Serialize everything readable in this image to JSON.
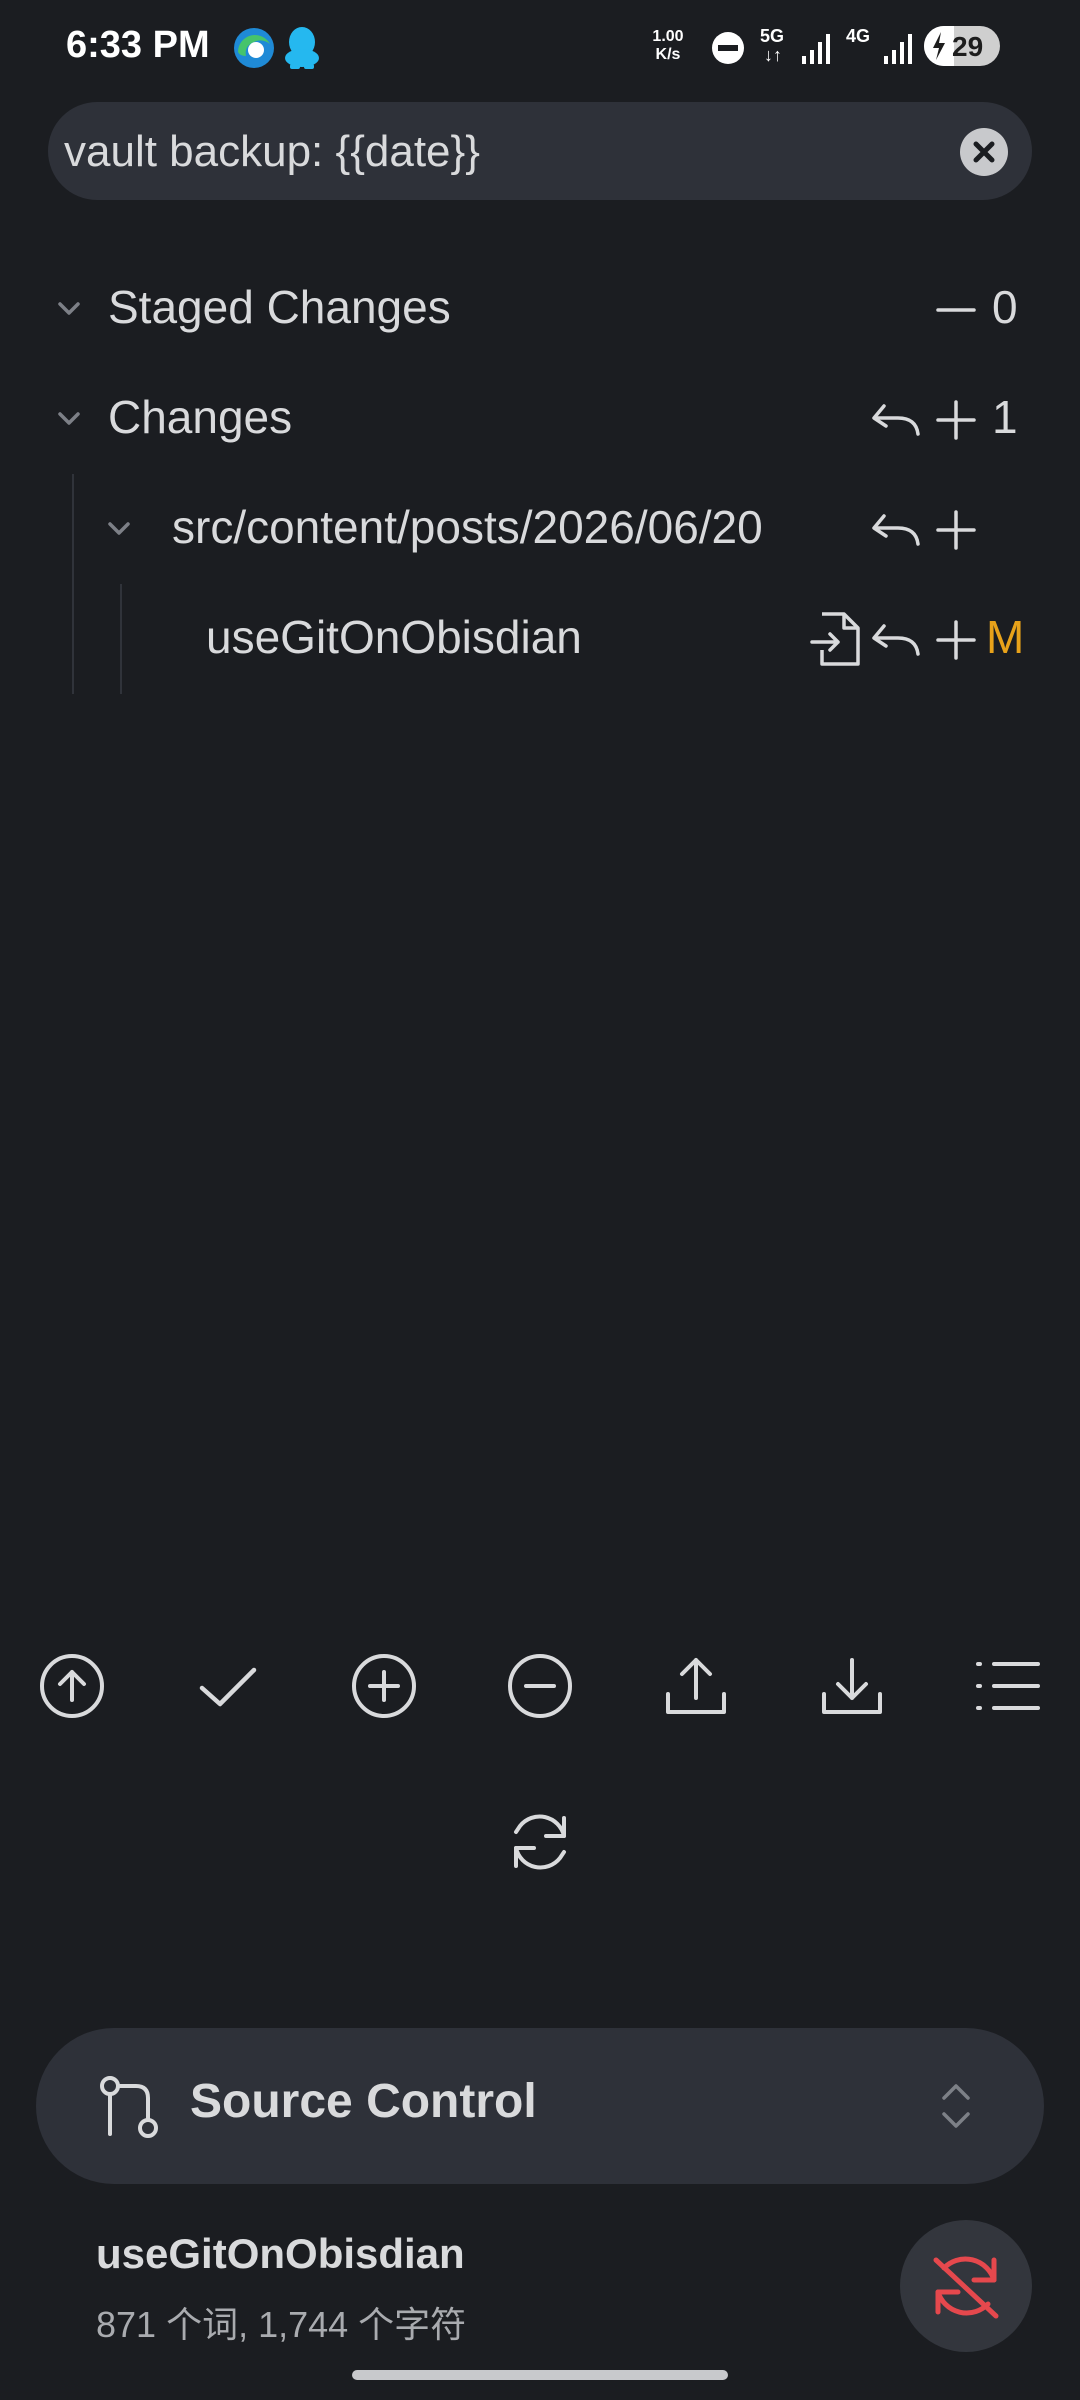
{
  "status_bar": {
    "time": "6:33 PM",
    "net_speed_value": "1.00",
    "net_speed_unit": "K/s",
    "net_5g": "5G",
    "net_4g": "4G",
    "battery": "29"
  },
  "commit": {
    "message": "vault backup: {{date}}"
  },
  "staged": {
    "label": "Staged Changes",
    "count": "0"
  },
  "changes": {
    "label": "Changes",
    "count": "1",
    "folder": "src/content/posts/2026/06/20",
    "file": {
      "name": "useGitOnObisdian",
      "status": "M"
    }
  },
  "colors": {
    "background": "#1b1d21",
    "surface": "#2e3139",
    "modified": "#e8a21a",
    "sync_off": "#e5484d"
  },
  "toolbar": [
    "upload-circle-icon",
    "check-icon",
    "plus-circle-icon",
    "minus-circle-icon",
    "push-icon",
    "pull-icon",
    "list-icon",
    "refresh-icon"
  ],
  "view": {
    "title": "Source Control"
  },
  "note": {
    "title": "useGitOnObisdian",
    "stats": "871 个词, 1,744 个字符"
  }
}
